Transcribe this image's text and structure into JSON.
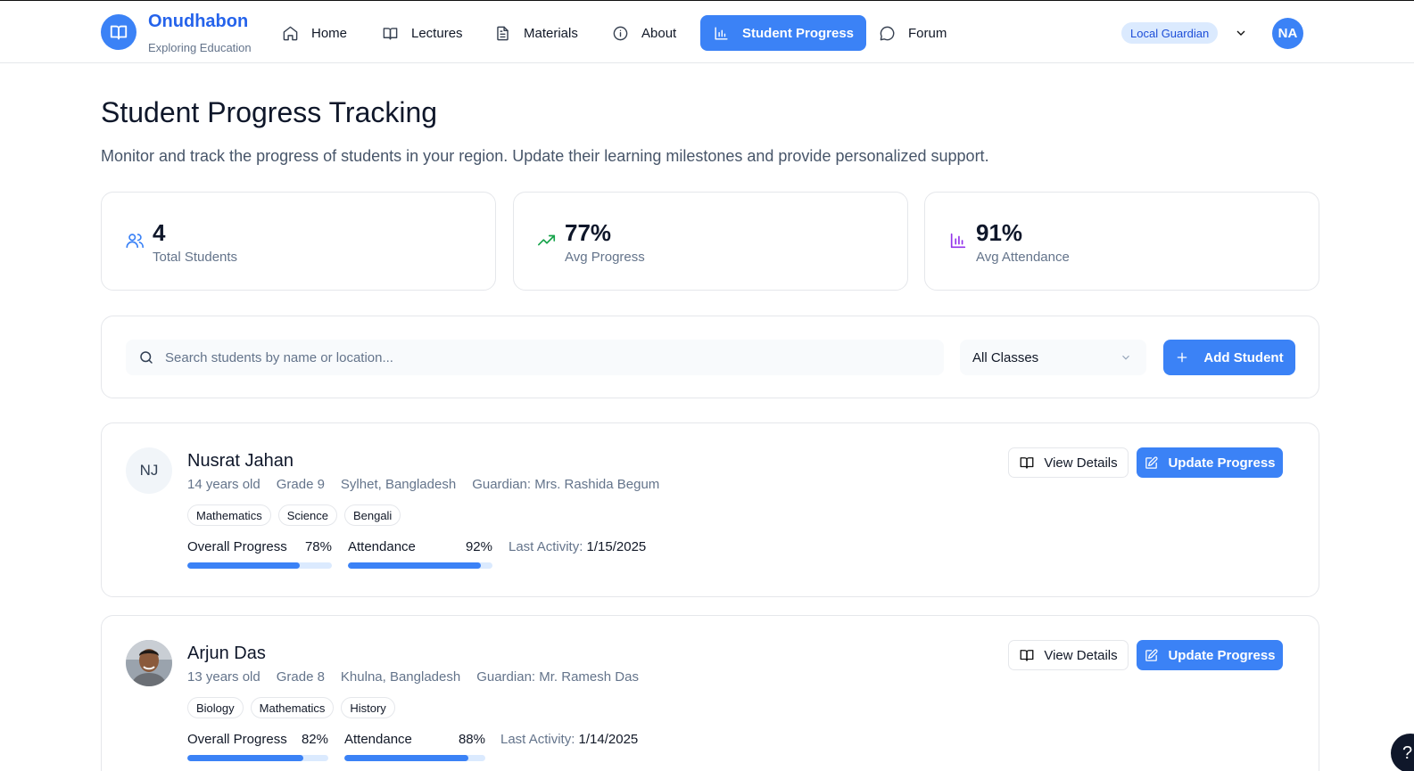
{
  "brand": {
    "name": "Onudhabon",
    "tagline": "Exploring Education",
    "color": "#3b82f6"
  },
  "nav": {
    "items": [
      {
        "label": "Home",
        "icon": "home-icon"
      },
      {
        "label": "Lectures",
        "icon": "book-icon"
      },
      {
        "label": "Materials",
        "icon": "document-icon"
      },
      {
        "label": "About",
        "icon": "info-icon"
      },
      {
        "label": "Student Progress",
        "icon": "bar-chart-icon",
        "active": true
      },
      {
        "label": "Forum",
        "icon": "chat-bubble-icon"
      }
    ],
    "role": "Local Guardian",
    "user_initials": "NA"
  },
  "page": {
    "title": "Student Progress Tracking",
    "description": "Monitor and track the progress of students in your region. Update their learning milestones and provide personalized support."
  },
  "stats": [
    {
      "value": "4",
      "label": "Total Students",
      "icon": "users-icon",
      "color": "#3b82f6"
    },
    {
      "value": "77%",
      "label": "Avg Progress",
      "icon": "trending-up-icon",
      "color": "#16a34a"
    },
    {
      "value": "91%",
      "label": "Avg Attendance",
      "icon": "bar-chart-icon",
      "color": "#9333ea"
    }
  ],
  "filters": {
    "search_placeholder": "Search students by name or location...",
    "class_selected": "All Classes",
    "add_label": "Add Student"
  },
  "students": [
    {
      "initials": "NJ",
      "name": "Nusrat Jahan",
      "age": "14 years old",
      "grade": "Grade 9",
      "location": "Sylhet, Bangladesh",
      "guardian": "Guardian: Mrs. Rashida Begum",
      "subjects": [
        "Mathematics",
        "Science",
        "Bengali"
      ],
      "progress_label": "Overall Progress",
      "progress": "78%",
      "progress_value": 0.78,
      "attendance_label": "Attendance",
      "attendance": "92%",
      "attendance_value": 0.92,
      "last_activity_label": "Last Activity:",
      "last_activity": "1/15/2025",
      "view_label": "View Details",
      "update_label": "Update Progress"
    },
    {
      "initials": "",
      "name": "Arjun Das",
      "age": "13 years old",
      "grade": "Grade 8",
      "location": "Khulna, Bangladesh",
      "guardian": "Guardian: Mr. Ramesh Das",
      "subjects": [
        "Biology",
        "Mathematics",
        "History"
      ],
      "progress_label": "Overall Progress",
      "progress": "82%",
      "progress_value": 0.82,
      "attendance_label": "Attendance",
      "attendance": "88%",
      "attendance_value": 0.88,
      "last_activity_label": "Last Activity:",
      "last_activity": "1/14/2025",
      "view_label": "View Details",
      "update_label": "Update Progress"
    }
  ],
  "help_label": "?"
}
